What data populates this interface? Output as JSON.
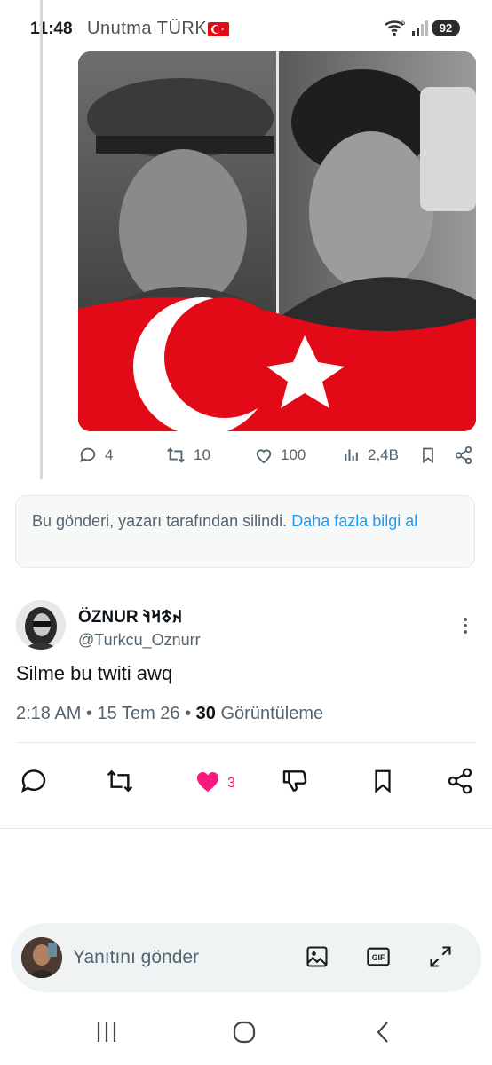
{
  "status_bar": {
    "time": "11:48",
    "title": "Unutma TÜRK",
    "battery": "92",
    "wifi_label": "5"
  },
  "post": {
    "image_desc_icon": "image",
    "actions": {
      "replies": "4",
      "reposts": "10",
      "likes": "100",
      "views": "2,4B"
    }
  },
  "deleted_notice": {
    "text": "Bu gönderi, yazarı tarafından silindi.",
    "link": "Daha fazla bilgi al"
  },
  "tweet": {
    "name": "ÖZNUR 𐰴𐱃𐰺𐰚",
    "handle": "@Turkcu_Oznurr",
    "text": "Silme bu twiti awq",
    "time": "2:18 AM",
    "date": "15 Tem 26",
    "views_count": "30",
    "views_label": "Görüntüleme",
    "like_count": "3"
  },
  "reply": {
    "placeholder": "Yanıtını gönder"
  },
  "colors": {
    "accent": "#1d9bf0",
    "like": "#f91880",
    "flag_red": "#e30a17"
  }
}
